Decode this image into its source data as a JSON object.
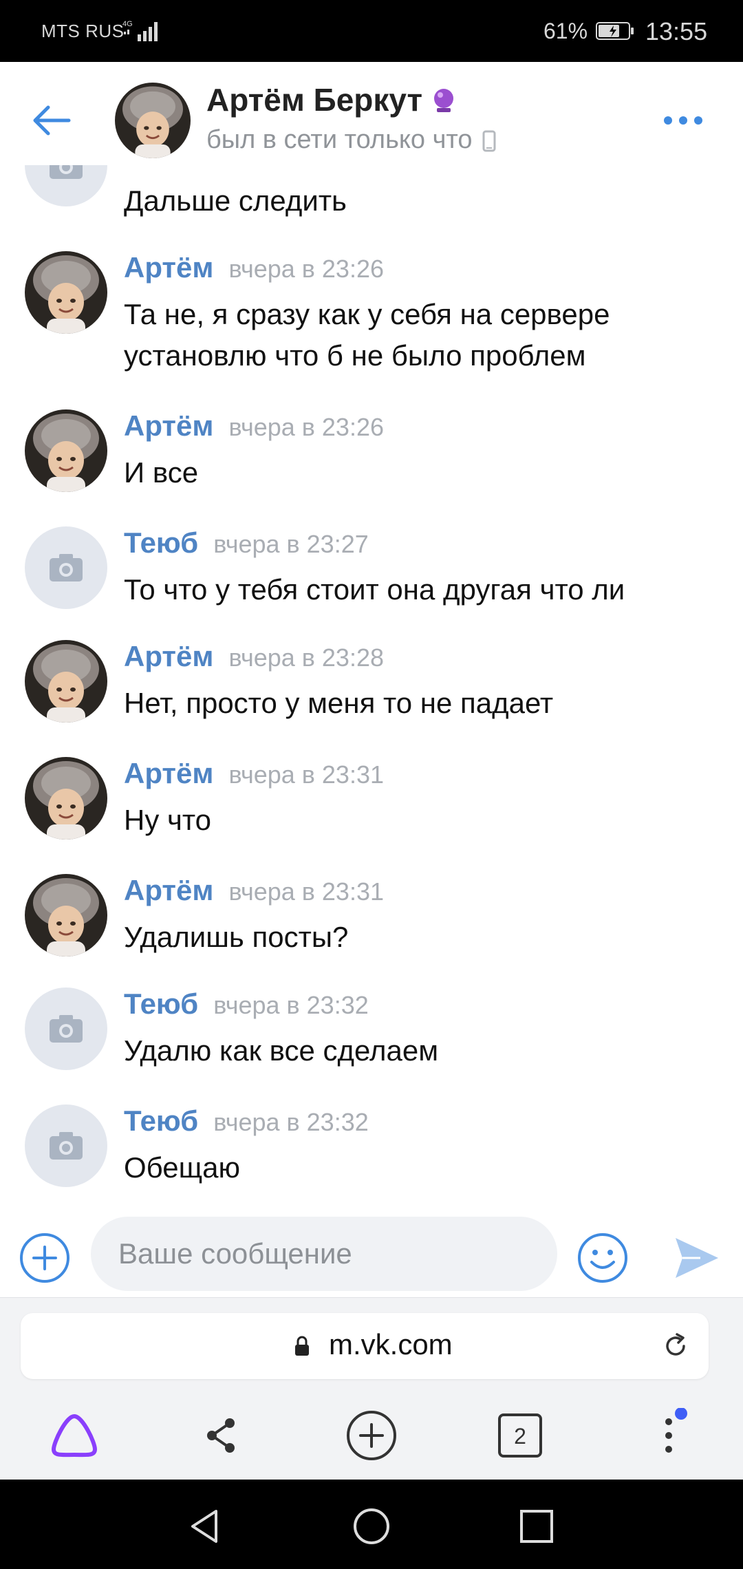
{
  "status_bar": {
    "carrier": "MTS RUS",
    "network": "4G",
    "battery_percent": "61%",
    "time": "13:55"
  },
  "header": {
    "name": "Артём Беркут",
    "status": "был в сети только что"
  },
  "partial_message": {
    "text": "Дальше следить"
  },
  "messages": [
    {
      "author": "Артём",
      "time": "вчера в 23:26",
      "text": "Та не, я сразу как у себя на сервере установлю что б не было проблем",
      "avatar": "photo"
    },
    {
      "author": "Артём",
      "time": "вчера в 23:26",
      "text": "И все",
      "avatar": "photo"
    },
    {
      "author": "Теюб",
      "time": "вчера в 23:27",
      "text": "То что у тебя стоит она другая что ли",
      "avatar": "camera"
    },
    {
      "author": "Артём",
      "time": "вчера в 23:28",
      "text": "Нет, просто у меня то не падает",
      "avatar": "photo"
    },
    {
      "author": "Артём",
      "time": "вчера в 23:31",
      "text": "Ну что",
      "avatar": "photo"
    },
    {
      "author": "Артём",
      "time": "вчера в 23:31",
      "text": "Удалишь посты?",
      "avatar": "photo"
    },
    {
      "author": "Теюб",
      "time": "вчера в 23:32",
      "text": "Удалю как все сделаем",
      "avatar": "camera"
    },
    {
      "author": "Теюб",
      "time": "вчера в 23:32",
      "text": "Обещаю",
      "avatar": "camera"
    }
  ],
  "composer": {
    "placeholder": "Ваше сообщение"
  },
  "browser": {
    "url": "m.vk.com",
    "tabs_count": "2"
  },
  "colors": {
    "accent": "#4f84c4",
    "name_link": "#4f84c4",
    "time_gray": "#a9adb3",
    "alice_purple": "#8a3ffc",
    "notification_dot": "#3f5ef6"
  }
}
